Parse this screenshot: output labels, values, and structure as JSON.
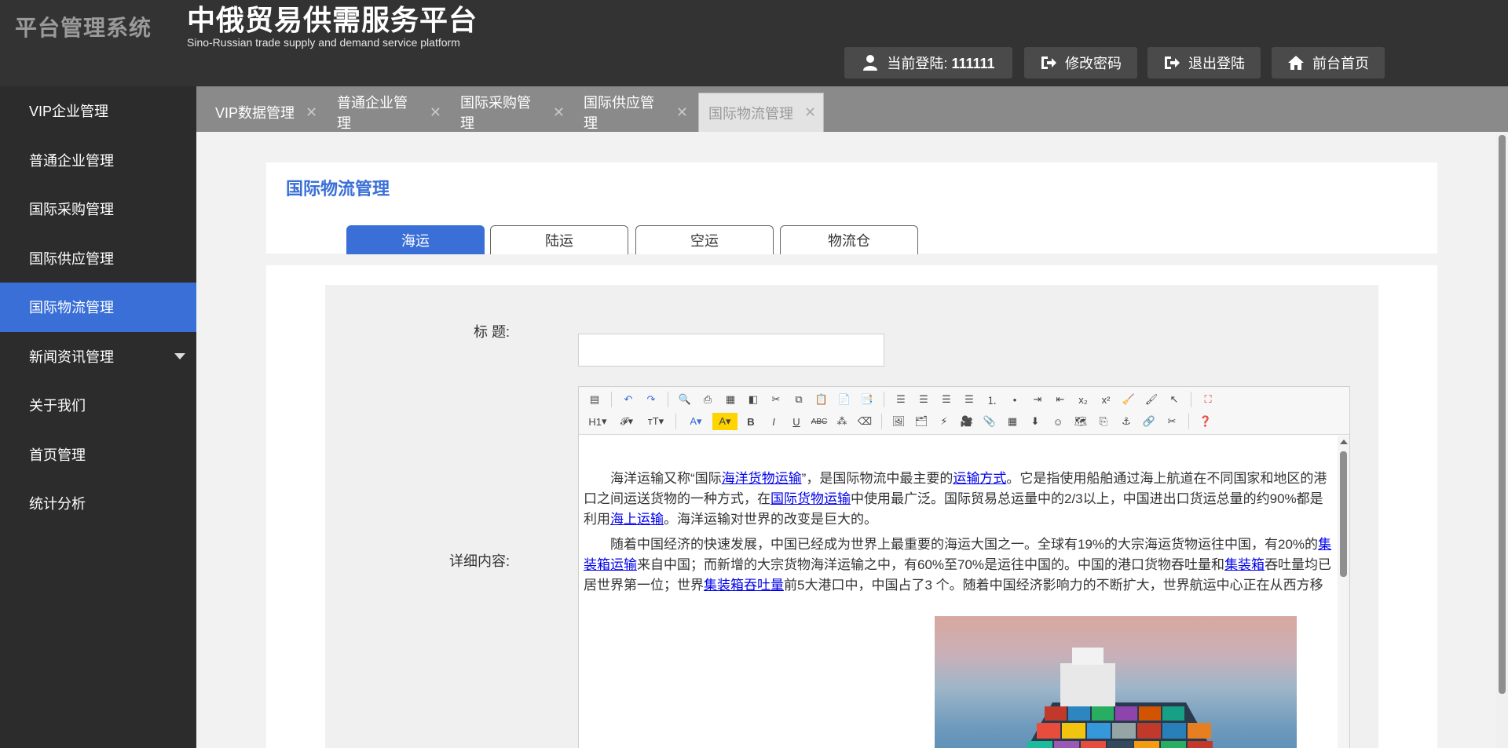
{
  "header": {
    "system_title": "平台管理系统",
    "brand_cn": "中俄贸易供需服务平台",
    "brand_en": "Sino-Russian trade supply and demand service platform",
    "login_label": "当前登陆:",
    "login_user": "111111",
    "change_password": "修改密码",
    "logout": "退出登陆",
    "home": "前台首页"
  },
  "sidebar": {
    "items": [
      {
        "label": "VIP企业管理"
      },
      {
        "label": "普通企业管理"
      },
      {
        "label": "国际采购管理"
      },
      {
        "label": "国际供应管理"
      },
      {
        "label": "国际物流管理"
      },
      {
        "label": "新闻资讯管理"
      },
      {
        "label": "关于我们"
      },
      {
        "label": "首页管理"
      },
      {
        "label": "统计分析"
      }
    ]
  },
  "tabs": [
    {
      "label": "VIP数据管理",
      "close": "✕"
    },
    {
      "label": "普通企业管理",
      "close": "✕"
    },
    {
      "label": "国际采购管理",
      "close": "✕"
    },
    {
      "label": "国际供应管理",
      "close": "✕"
    },
    {
      "label": "国际物流管理",
      "close": "✕"
    }
  ],
  "page": {
    "title": "国际物流管理",
    "sub_tabs": [
      "海运",
      "陆运",
      "空运",
      "物流仓"
    ]
  },
  "form": {
    "title_label": "标 题:",
    "title_value": "",
    "detail_label": "详细内容:"
  },
  "editor": {
    "toolbar_heading": "H1",
    "para1": {
      "t1": "海洋运输又称“国际",
      "l1": "海洋货物运输",
      "t2": "”，是国际物流中最主要的",
      "l2": "运输方式",
      "t3": "。它是指使用船舶通过海上航道在不同国家和地区的港口之间运送货物的一种方式，在",
      "l3": "国际货物运输",
      "t4": "中使用最广泛。国际贸易总运量中的2/3以上，中国进出口货运总量的约90%都是利用",
      "l4": "海上运输",
      "t5": "。海洋运输对世界的改变是巨大的。"
    },
    "para2": {
      "t1": "随着中国经济的快速发展，中国已经成为世界上最重要的海运大国之一。全球有19%的大宗海运货物运往中国，有20%的",
      "l1": "集装箱运输",
      "t2": "来自中国；而新增的大宗货物海洋运输之中，有60%至70%是运往中国的。中国的港口货物吞吐量和",
      "l2": "集装箱",
      "t3": "吞吐量均已居世界第一位；世界",
      "l3": "集装箱吞吐量",
      "t4": "前5大港口中，中国占了3 个。随着中国经济影响力的不断扩大，世界航运中心正在从西方移"
    }
  },
  "colors": {
    "header_bg": "#333333",
    "sidebar_bg": "#2c2c2c",
    "accent": "#3a6fd8",
    "tabbar_bg": "#8a8a8a"
  }
}
